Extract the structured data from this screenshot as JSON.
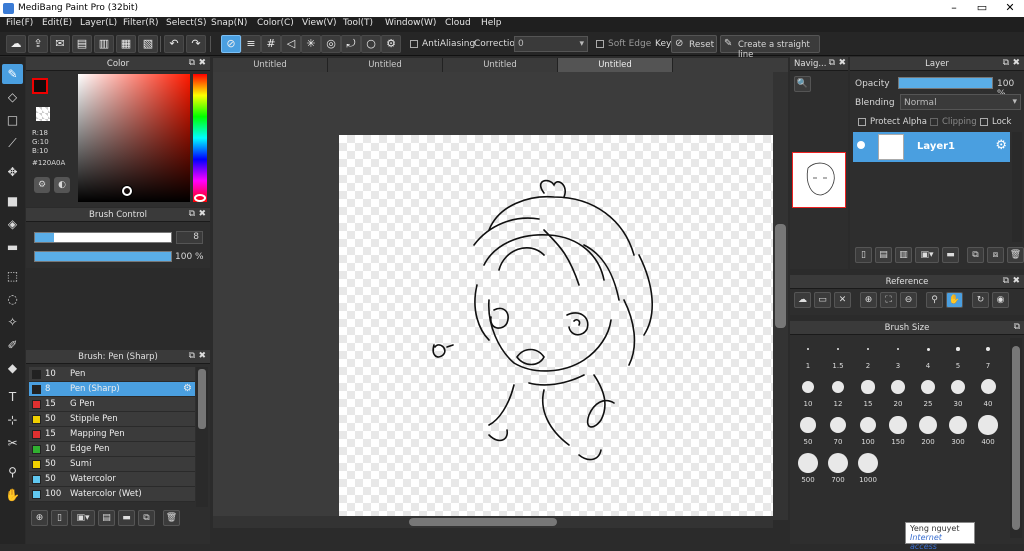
{
  "app": {
    "title": "MediBang Paint Pro (32bit)"
  },
  "menu": [
    "File(F)",
    "Edit(E)",
    "Layer(L)",
    "Filter(R)",
    "Select(S)",
    "Snap(N)",
    "Color(C)",
    "View(V)",
    "Tool(T)",
    "Window(W)",
    "Cloud",
    "Help"
  ],
  "toolbar": {
    "antialiasing": "AntiAliasing",
    "correction_label": "Correction",
    "correction_value": "0",
    "soft_edge": "Soft Edge",
    "key": "Key",
    "reset": "Reset",
    "straight_line": "Create a straight line"
  },
  "color_panel": {
    "title": "Color",
    "r": "R:18",
    "g": "G:10",
    "b": "B:10",
    "hex": "#120A0A",
    "fg_color": "#120a0a"
  },
  "brush_control": {
    "title": "Brush Control",
    "size": "8",
    "opacity": "100 %"
  },
  "brush_list": {
    "title": "Brush: Pen (Sharp)",
    "items": [
      {
        "size": "10",
        "name": "Pen",
        "color": "#222222"
      },
      {
        "size": "8",
        "name": "Pen (Sharp)",
        "color": "#222222"
      },
      {
        "size": "15",
        "name": "G Pen",
        "color": "#e03030"
      },
      {
        "size": "50",
        "name": "Stipple Pen",
        "color": "#f0d000"
      },
      {
        "size": "15",
        "name": "Mapping Pen",
        "color": "#e03030"
      },
      {
        "size": "10",
        "name": "Edge Pen",
        "color": "#30b030"
      },
      {
        "size": "50",
        "name": "Sumi",
        "color": "#f0d000"
      },
      {
        "size": "50",
        "name": "Watercolor",
        "color": "#60c8f0"
      },
      {
        "size": "100",
        "name": "Watercolor (Wet)",
        "color": "#60c8f0"
      }
    ]
  },
  "tabs": [
    "Untitled",
    "Untitled",
    "Untitled",
    "Untitled"
  ],
  "navigator": {
    "title": "Navig..."
  },
  "layer_panel": {
    "title": "Layer",
    "opacity_label": "Opacity",
    "opacity_value": "100 %",
    "blending_label": "Blending",
    "blending_value": "Normal",
    "protect_alpha": "Protect Alpha",
    "clipping": "Clipping",
    "lock": "Lock",
    "layer_name": "Layer1"
  },
  "reference": {
    "title": "Reference"
  },
  "brush_size": {
    "title": "Brush Size",
    "sizes": [
      "1",
      "1.5",
      "2",
      "3",
      "4",
      "5",
      "7",
      "10",
      "12",
      "15",
      "20",
      "25",
      "30",
      "40",
      "50",
      "70",
      "100",
      "150",
      "200",
      "300",
      "400",
      "500",
      "700",
      "1000"
    ]
  },
  "tooltip": {
    "line1": "Yeng nguyet",
    "line2": "Internet access"
  }
}
